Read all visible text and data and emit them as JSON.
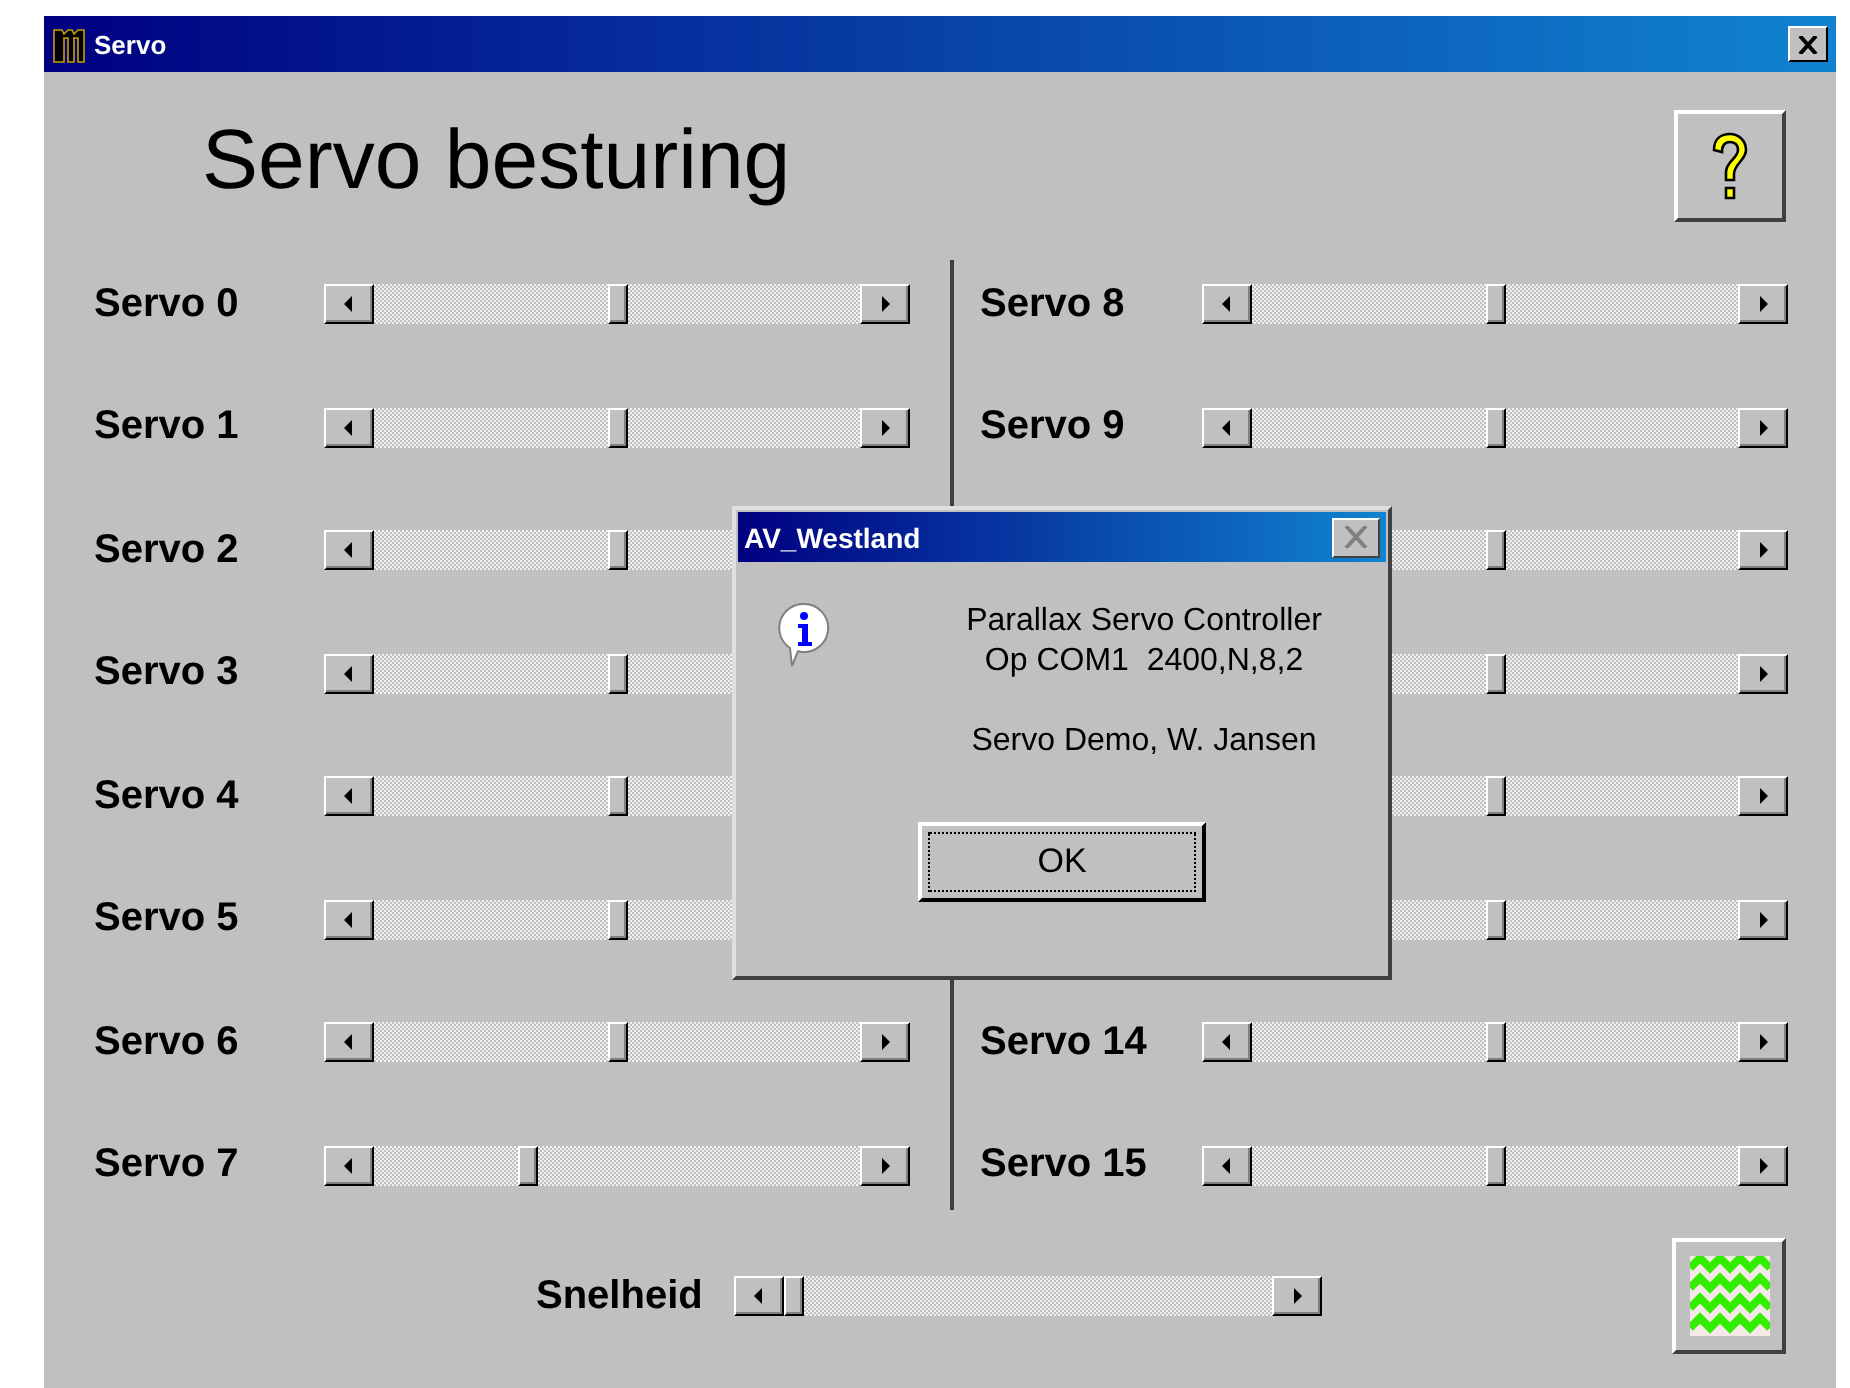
{
  "window": {
    "title": "Servo"
  },
  "heading": "Servo besturing",
  "servos": {
    "left": [
      {
        "kind": "labeled",
        "label": "Servo 0"
      },
      {
        "kind": "labeled",
        "label": "Servo 1"
      },
      {
        "kind": "labeled",
        "label": "Servo 2"
      },
      {
        "kind": "labeled",
        "label": "Servo 3"
      },
      {
        "kind": "labeled",
        "label": "Servo 4"
      },
      {
        "kind": "labeled",
        "label": "Servo 5"
      },
      {
        "kind": "labeled",
        "label": "Servo 6"
      },
      {
        "kind": "labeled",
        "label": "Servo 7"
      }
    ],
    "right": [
      {
        "kind": "labeled",
        "label": "Servo 8"
      },
      {
        "kind": "labeled",
        "label": "Servo 9"
      },
      {
        "kind": "covered"
      },
      {
        "kind": "covered"
      },
      {
        "kind": "covered"
      },
      {
        "kind": "covered"
      },
      {
        "kind": "labeled",
        "label": "Servo 14"
      },
      {
        "kind": "labeled",
        "label": "Servo 15"
      }
    ]
  },
  "speed": {
    "label": "Snelheid"
  },
  "dialog": {
    "title": "AV_Westland",
    "message": [
      "Parallax Servo Controller",
      "Op COM1  2400,N,8,2"
    ],
    "note": "Servo Demo, W. Jansen",
    "button": "OK"
  }
}
